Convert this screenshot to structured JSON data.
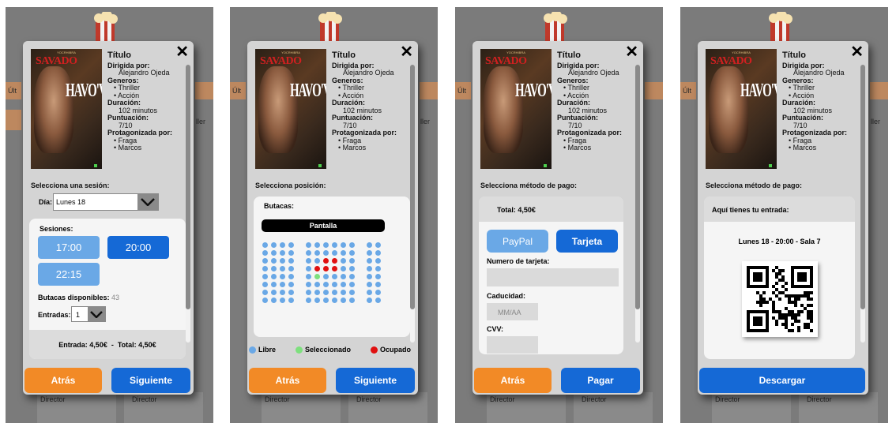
{
  "background": {
    "left_tab": "Últ",
    "right_tab": "ller",
    "director_label": "Director"
  },
  "movie": {
    "poster_text_top": "YOCRHIBRA",
    "poster_title_1": "SAVADO",
    "poster_title_2": "HAVO'V",
    "title": "Título",
    "directed_label": "Dirigida por:",
    "director": "Alejandro Ojeda",
    "genres_label": "Generos:",
    "genres": [
      "Thriller",
      "Acción"
    ],
    "duration_label": "Duración:",
    "duration": "102 minutos",
    "score_label": "Puntuación:",
    "score": "7/10",
    "cast_label": "Protagonizada por:",
    "cast": [
      "Fraga",
      "Marcos"
    ],
    "close": "✕"
  },
  "screen1": {
    "section": "Selecciona una sesión:",
    "day_label": "Día:",
    "day_value": "Lunes 18",
    "sessions_label": "Sesiones:",
    "sessions": [
      "17:00",
      "20:00",
      "22:15"
    ],
    "seats_label": "Butacas disponibles:",
    "seats_count": "43",
    "entries_label": "Entradas:",
    "entries_value": "1",
    "price_summary": "Entrada: 4,50€  -  Total: 4,50€",
    "back": "Atrás",
    "next": "Siguiente"
  },
  "screen2": {
    "section": "Selecciona posición:",
    "seats_label": "Butacas:",
    "screen_label": "Pantalla",
    "legend_free": "Libre",
    "legend_selected": "Seleccionado",
    "legend_taken": "Ocupado",
    "back": "Atrás",
    "next": "Siguiente"
  },
  "screen3": {
    "section": "Selecciona método de pago:",
    "total": "Total: 4,50€",
    "paypal": "PayPal",
    "card": "Tarjeta",
    "card_number_label": "Numero de tarjeta:",
    "expiry_label": "Caducidad:",
    "expiry_placeholder": "MM/AA",
    "cvv_label": "CVV:",
    "back": "Atrás",
    "pay": "Pagar"
  },
  "screen4": {
    "section": "Selecciona método de pago:",
    "ticket_label": "Aquí tienes tu entrada:",
    "ticket_info": "Lunes 18 - 20:00 - Sala 7",
    "download": "Descargar"
  },
  "colors": {
    "orange": "#f28a26",
    "blue": "#1569d6",
    "light_blue": "#6aa8e6",
    "selected_green": "#7ee07e",
    "taken_red": "#e01010"
  }
}
